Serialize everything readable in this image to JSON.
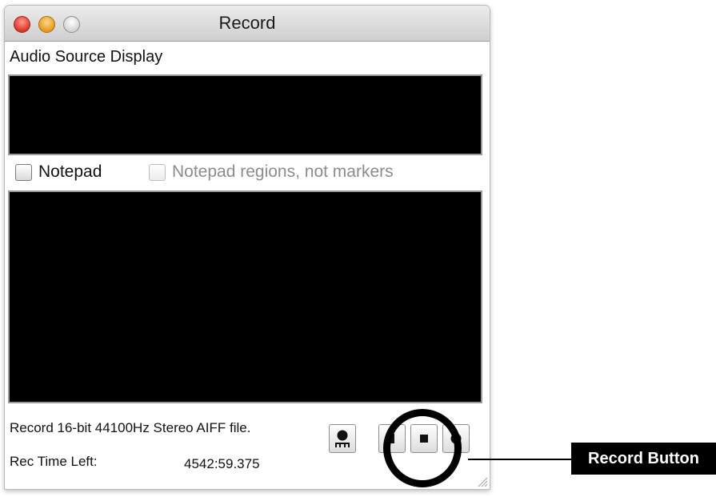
{
  "window": {
    "title": "Record",
    "controls": [
      "close-icon",
      "minimize-icon",
      "zoom-icon"
    ]
  },
  "audio_source": {
    "label": "Audio Source Display"
  },
  "notepad": {
    "checkbox_label": "Notepad",
    "checked": false,
    "regions_label": "Notepad regions, not markers",
    "regions_checked": false
  },
  "status": {
    "format_text": "Record 16-bit 44100Hz Stereo AIFF file.",
    "time_left_label": "Rec Time Left:",
    "time_left_value": "4542:59.375"
  },
  "transport": {
    "buttons": [
      "level-meter-icon",
      "pause-icon",
      "stop-icon",
      "record-icon"
    ]
  },
  "annotation": {
    "callout_label": "Record Button",
    "color": "#000000"
  }
}
